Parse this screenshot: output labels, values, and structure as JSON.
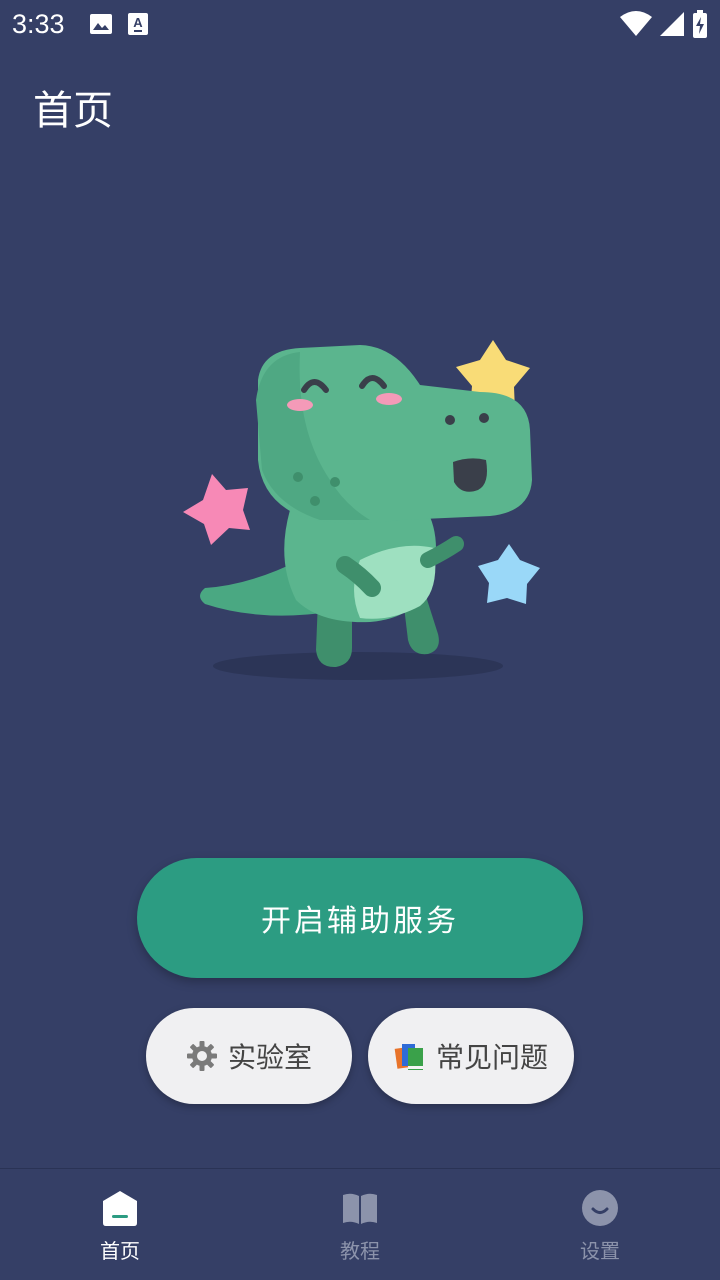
{
  "status_bar": {
    "time": "3:33",
    "icons": [
      "image-notification-icon",
      "text-notification-icon",
      "wifi-icon",
      "signal-icon",
      "battery-charging-icon"
    ]
  },
  "page": {
    "title": "首页"
  },
  "main": {
    "primary_button_label": "开启辅助服务",
    "lab_button_label": "实验室",
    "faq_button_label": "常见问题"
  },
  "bottom_nav": {
    "items": [
      {
        "label": "首页",
        "icon": "home-icon",
        "active": true
      },
      {
        "label": "教程",
        "icon": "book-icon",
        "active": false
      },
      {
        "label": "设置",
        "icon": "smile-icon",
        "active": false
      }
    ]
  },
  "colors": {
    "background": "#353f66",
    "accent": "#2c9c82",
    "pill": "#f0f0f2",
    "nav_inactive": "#8c93ab"
  }
}
